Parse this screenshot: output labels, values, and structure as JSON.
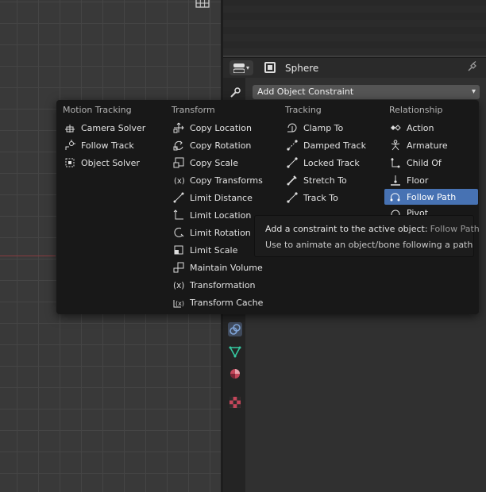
{
  "properties": {
    "object_name": "Sphere",
    "add_constraint_label": "Add Object Constraint"
  },
  "menu": {
    "columns": [
      {
        "header": "Motion Tracking",
        "items": [
          {
            "label": "Camera Solver",
            "icon": "camera-solver-icon"
          },
          {
            "label": "Follow Track",
            "icon": "follow-track-icon"
          },
          {
            "label": "Object Solver",
            "icon": "object-solver-icon"
          }
        ]
      },
      {
        "header": "Transform",
        "items": [
          {
            "label": "Copy Location",
            "icon": "copy-location-icon"
          },
          {
            "label": "Copy Rotation",
            "icon": "copy-rotation-icon"
          },
          {
            "label": "Copy Scale",
            "icon": "copy-scale-icon"
          },
          {
            "label": "Copy Transforms",
            "icon": "copy-transforms-icon"
          },
          {
            "label": "Limit Distance",
            "icon": "limit-distance-icon"
          },
          {
            "label": "Limit Location",
            "icon": "limit-location-icon"
          },
          {
            "label": "Limit Rotation",
            "icon": "limit-rotation-icon"
          },
          {
            "label": "Limit Scale",
            "icon": "limit-scale-icon"
          },
          {
            "label": "Maintain Volume",
            "icon": "maintain-volume-icon"
          },
          {
            "label": "Transformation",
            "icon": "transformation-icon"
          },
          {
            "label": "Transform Cache",
            "icon": "transform-cache-icon"
          }
        ]
      },
      {
        "header": "Tracking",
        "items": [
          {
            "label": "Clamp To",
            "icon": "clamp-to-icon"
          },
          {
            "label": "Damped Track",
            "icon": "damped-track-icon"
          },
          {
            "label": "Locked Track",
            "icon": "locked-track-icon"
          },
          {
            "label": "Stretch To",
            "icon": "stretch-to-icon"
          },
          {
            "label": "Track To",
            "icon": "track-to-icon"
          }
        ]
      },
      {
        "header": "Relationship",
        "items": [
          {
            "label": "Action",
            "icon": "action-icon"
          },
          {
            "label": "Armature",
            "icon": "armature-icon"
          },
          {
            "label": "Child Of",
            "icon": "child-of-icon"
          },
          {
            "label": "Floor",
            "icon": "floor-icon"
          },
          {
            "label": "Follow Path",
            "icon": "follow-path-icon",
            "selected": true
          },
          {
            "label": "Pivot",
            "icon": "pivot-icon"
          }
        ]
      }
    ]
  },
  "tooltip": {
    "line1": "Add a constraint to the active object:",
    "python": "Follow Path",
    "line2": "Use to animate an object/bone following a path"
  },
  "colors": {
    "selection": "#4772b3",
    "menu_bg": "#181818",
    "viewport_bg": "#393939"
  }
}
